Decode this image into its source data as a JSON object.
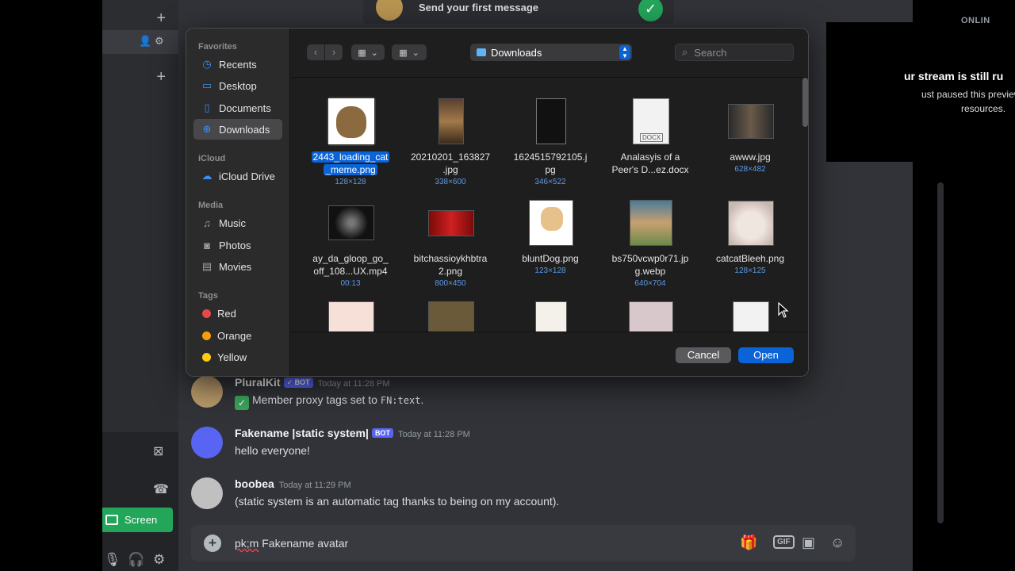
{
  "background": {
    "first_message": "Send your first message",
    "stream": {
      "online_label": "ONLIN",
      "title": "ur stream is still ru",
      "line1": "ust paused this preview",
      "line2": "resources."
    },
    "screen_button": "Screen",
    "messages": [
      {
        "name": "PluralKit",
        "badge": "✓ BOT",
        "time": "Today at 11:28 PM",
        "text_prefix": "Member proxy tags set to",
        "code": "FN:text",
        "text_suffix": "."
      },
      {
        "name": "Fakename |static system|",
        "badge": "BOT",
        "time": "Today at 11:28 PM",
        "text": "hello everyone!"
      },
      {
        "name": "boobea",
        "time": "Today at 11:29 PM",
        "text": "(static system is an automatic tag thanks to being on my account)."
      }
    ],
    "composer": {
      "pk": "pk;m",
      "rest": " Fakename avatar",
      "gif": "GIF"
    }
  },
  "dialog": {
    "sidebar": {
      "favorites_title": "Favorites",
      "favorites": [
        "Recents",
        "Desktop",
        "Documents",
        "Downloads"
      ],
      "selected": "Downloads",
      "icloud_title": "iCloud",
      "icloud": [
        "iCloud Drive"
      ],
      "media_title": "Media",
      "media": [
        "Music",
        "Photos",
        "Movies"
      ],
      "tags_title": "Tags",
      "tags": [
        {
          "label": "Red",
          "color": "#e5484d"
        },
        {
          "label": "Orange",
          "color": "#f59e0b"
        },
        {
          "label": "Yellow",
          "color": "#facc15"
        }
      ]
    },
    "location": "Downloads",
    "search_placeholder": "Search",
    "files": [
      {
        "name1": "2443_loading_cat",
        "name2": "_meme.png",
        "meta": "128×128",
        "selected": true
      },
      {
        "name1": "20210201_163827",
        "name2": ".jpg",
        "meta": "338×600"
      },
      {
        "name1": "1624515792105.j",
        "name2": "pg",
        "meta": "346×522"
      },
      {
        "name1": "Analasyis of a",
        "name2": "Peer's D...ez.docx",
        "meta": ""
      },
      {
        "name1": "awww.jpg",
        "name2": "",
        "meta": "628×482"
      },
      {
        "name1": "ay_da_gloop_go_",
        "name2": "off_108...UX.mp4",
        "meta": "00:13"
      },
      {
        "name1": "bitchassioykhbtra",
        "name2": "2.png",
        "meta": "800×450"
      },
      {
        "name1": "bluntDog.png",
        "name2": "",
        "meta": "123×128"
      },
      {
        "name1": "bs750vcwp0r71.jp",
        "name2": "g.webp",
        "meta": "640×704"
      },
      {
        "name1": "catcatBleeh.png",
        "name2": "",
        "meta": "128×125"
      }
    ],
    "docx_label": "DOCX",
    "cancel": "Cancel",
    "open": "Open"
  }
}
